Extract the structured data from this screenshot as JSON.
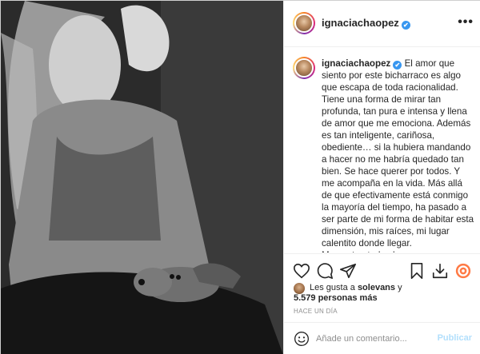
{
  "post": {
    "username": "ignaciachaopez",
    "verified_badge": "✔",
    "more_icon": "•••",
    "caption_username": "ignaciachaopez",
    "caption": " El amor que siento por este bicharraco es algo que escapa de toda racionalidad. Tiene una forma de mirar tan profunda, tan pura e intensa y llena de amor que me emociona. Además es tan inteligente, cariñosa, obediente… si la hubiera mandando a hacer no me habría quedado tan bien. Se hace querer por todos. Y me acompaña en la vida. Más allá de que efectivamente está conmigo la mayoría del tiempo, ha pasado a ser parte de mi forma de habitar esta dimensión, mis raíces, mi lugar calentito donde llegar.\nMe gustan todos los perros. Grandes, chicos, peludos, pelados, miniatura, horrendos, pituqos, todos",
    "likes_prefix": "Les gusta a ",
    "likes_user": "solevans",
    "likes_suffix": " y",
    "likes_count": "5.579 personas más",
    "time_ago": "HACE UN DÍA",
    "comment_placeholder": "Añade un comentario...",
    "publish_label": "Publicar",
    "accent_color": "#3897f0",
    "publish_color": "#b2dffc"
  },
  "icons": {
    "like": "heart-icon",
    "comment": "comment-icon",
    "share": "share-icon",
    "save": "bookmark-icon",
    "download": "download-icon",
    "extension": "extension-icon",
    "emoji": "emoji-icon"
  }
}
